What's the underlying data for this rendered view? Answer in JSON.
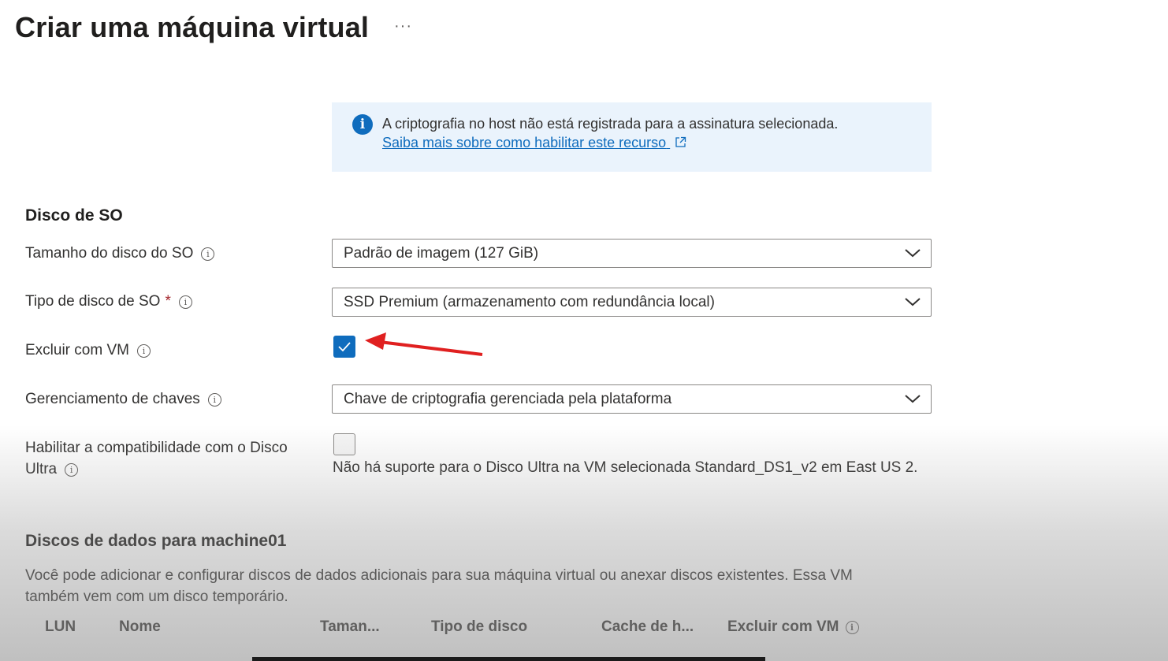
{
  "header": {
    "title": "Criar uma máquina virtual",
    "more_label": "···"
  },
  "info": {
    "icon": "info-icon",
    "text": "A criptografia no host não está registrada para a assinatura selecionada.",
    "link": "Saiba mais sobre como habilitar este recurso"
  },
  "os_disk": {
    "section_title": "Disco de SO",
    "size_label": "Tamanho do disco do SO",
    "size_value": "Padrão de imagem (127 GiB)",
    "type_label": "Tipo de disco de SO",
    "required_mark": "*",
    "type_value": "SSD Premium (armazenamento com redundância local)",
    "delete_label": "Excluir com VM",
    "delete_checked": true,
    "key_label": "Gerenciamento de chaves",
    "key_value": "Chave de criptografia gerenciada pela plataforma",
    "ultra_label_line1": "Habilitar a compatibilidade com o Disco",
    "ultra_label_line2": "Ultra",
    "ultra_checked": false,
    "ultra_note": "Não há suporte para o Disco Ultra na VM selecionada Standard_DS1_v2 em East US 2."
  },
  "data_disks": {
    "section_title": "Discos de dados para machine01",
    "description": "Você pode adicionar e configurar discos de dados adicionais para sua máquina virtual ou anexar discos existentes. Essa VM também vem com um disco temporário.",
    "columns": [
      "LUN",
      "Nome",
      "Taman...",
      "Tipo de disco",
      "Cache de h...",
      "Excluir com VM"
    ]
  },
  "colors": {
    "accent": "#0f6cbd",
    "info_bg": "#eaf3fc",
    "required": "#a4262c",
    "annotation_arrow": "#e02020"
  }
}
